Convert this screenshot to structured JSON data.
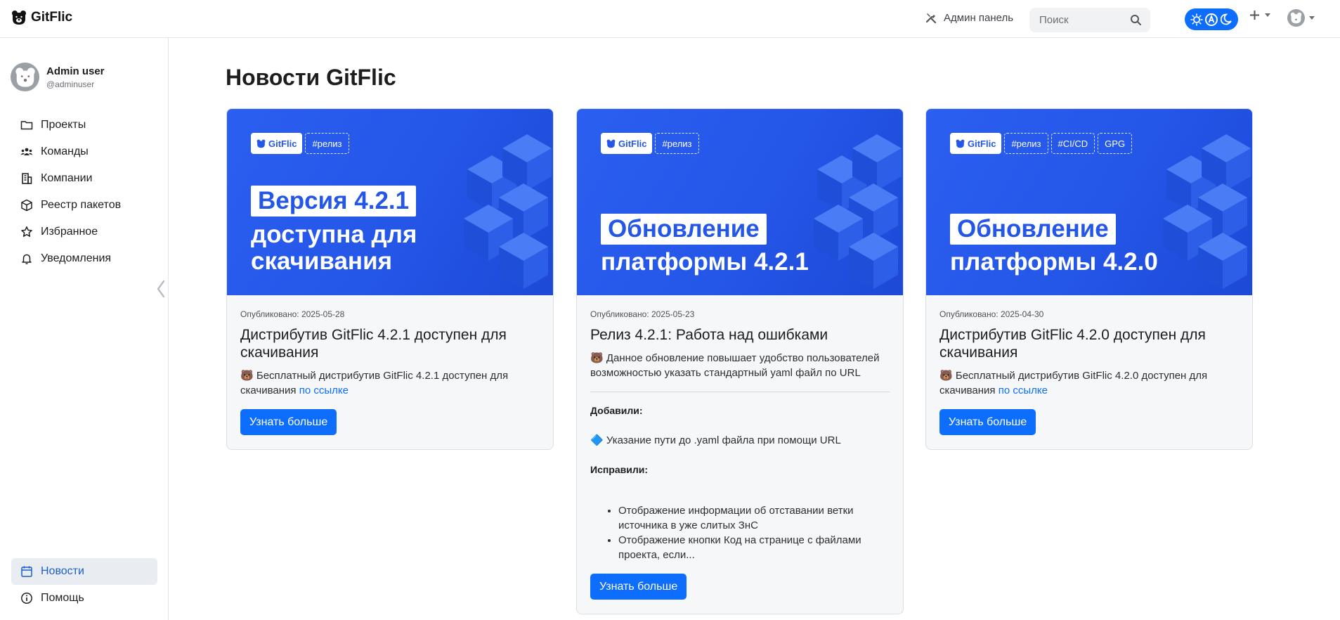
{
  "header": {
    "logo_text": "GitFlic",
    "admin_label": "Админ панель",
    "search_placeholder": "Поиск"
  },
  "sidebar": {
    "user_name": "Admin user",
    "user_login": "@adminuser",
    "items": [
      {
        "label": "Проекты",
        "icon": "folder-icon"
      },
      {
        "label": "Команды",
        "icon": "team-icon"
      },
      {
        "label": "Компании",
        "icon": "building-icon"
      },
      {
        "label": "Реестр пакетов",
        "icon": "package-icon"
      },
      {
        "label": "Избранное",
        "icon": "star-icon"
      },
      {
        "label": "Уведомления",
        "icon": "bell-icon"
      }
    ],
    "bottom_items": [
      {
        "label": "Новости",
        "icon": "calendar-icon",
        "active": true
      },
      {
        "label": "Помощь",
        "icon": "info-icon"
      }
    ]
  },
  "main": {
    "title": "Новости GitFlic",
    "cards": [
      {
        "tags": [
          "#релиз"
        ],
        "brand": "GitFlic",
        "banner_head": "Версия 4.2.1",
        "banner_lines": [
          "доступна для",
          "скачивания"
        ],
        "published": "Опубликовано: 2025-05-28",
        "title": "Дистрибутив GitFlic 4.2.1 доступен для скачивания",
        "text": "🐻 Бесплатный дистрибутив GitFlic 4.2.1 доступен для скачивания",
        "link": "по ссылке",
        "button": "Узнать больше"
      },
      {
        "tags": [
          "#релиз"
        ],
        "brand": "GitFlic",
        "banner_head": "Обновление",
        "banner_lines": [
          "платформы 4.2.1"
        ],
        "published": "Опубликовано: 2025-05-23",
        "title": "Релиз 4.2.1: Работа над ошибками",
        "text": "🐻 Данное обновление повышает удобство пользователей возможностью указать стандартный yaml файл по URL",
        "added_label": "Добавили:",
        "added_item": "🔷 Указание пути до .yaml файла при помощи URL",
        "fixed_label": "Исправили:",
        "fixed_items": [
          "Отображение информации об отставании ветки источника в уже слитых ЗнС",
          "Отображение кнопки Код на странице с файлами проекта, если..."
        ],
        "button": "Узнать больше"
      },
      {
        "tags": [
          "#релиз",
          "#CI/CD",
          "GPG"
        ],
        "brand": "GitFlic",
        "banner_head": "Обновление",
        "banner_lines": [
          "платформы 4.2.0"
        ],
        "published": "Опубликовано: 2025-04-30",
        "title": "Дистрибутив GitFlic 4.2.0 доступен для скачивания",
        "text": "🐻 Бесплатный дистрибутив GitFlic 4.2.0 доступен для скачивания",
        "link": "по ссылке",
        "button": "Узнать больше"
      }
    ]
  },
  "colors": {
    "accent": "#0d6efd",
    "banner": "#2456e8",
    "active_nav_bg": "#e9ecf0"
  }
}
